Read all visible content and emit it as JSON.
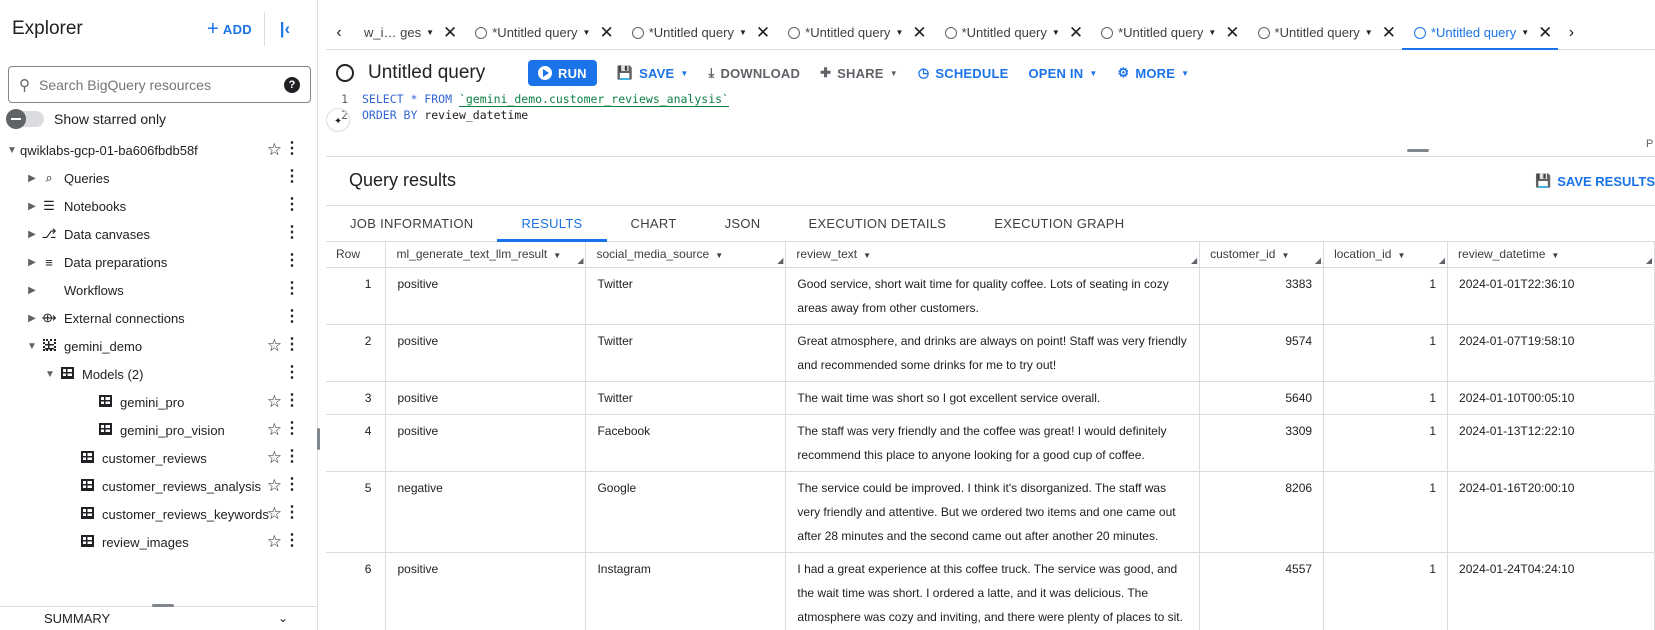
{
  "explorer": {
    "title": "Explorer",
    "add_label": "ADD",
    "search_placeholder": "Search BigQuery resources",
    "starred_label": "Show starred only",
    "project": "qwiklabs-gcp-01-ba606fbdb58f",
    "project_items": [
      {
        "label": "Queries",
        "icon": "queries-icon"
      },
      {
        "label": "Notebooks",
        "icon": "notebook-icon"
      },
      {
        "label": "Data canvases",
        "icon": "data-canvas-icon"
      },
      {
        "label": "Data preparations",
        "icon": "data-prep-icon"
      },
      {
        "label": "Workflows",
        "icon": "workflow-icon"
      },
      {
        "label": "External connections",
        "icon": "connection-icon"
      }
    ],
    "dataset": "gemini_demo",
    "models_label": "Models (2)",
    "models": [
      "gemini_pro",
      "gemini_pro_vision"
    ],
    "tables": [
      "customer_reviews",
      "customer_reviews_analysis",
      "customer_reviews_keywords",
      "review_images"
    ],
    "summary_label": "SUMMARY"
  },
  "tabs": {
    "first_tab": "w_i…  ges",
    "untitled": "*Untitled query",
    "untitled_count": 7
  },
  "toolbar": {
    "title": "Untitled query",
    "run": "RUN",
    "save": "SAVE",
    "download": "DOWNLOAD",
    "share": "SHARE",
    "schedule": "SCHEDULE",
    "open_in": "OPEN IN",
    "more": "MORE"
  },
  "editor": {
    "line1_kw": "SELECT * FROM",
    "line1_table": "`gemini_demo.customer_reviews_analysis`",
    "line2_kw": "ORDER BY",
    "line2_col": "review_datetime",
    "corner_text": "P"
  },
  "results": {
    "title": "Query results",
    "save_results": "SAVE RESULTS",
    "tabs": [
      "JOB INFORMATION",
      "RESULTS",
      "CHART",
      "JSON",
      "EXECUTION DETAILS",
      "EXECUTION GRAPH"
    ],
    "active_tab": "RESULTS",
    "columns": [
      "Row",
      "ml_generate_text_llm_result",
      "social_media_source",
      "review_text",
      "customer_id",
      "location_id",
      "review_datetime"
    ],
    "rows": [
      {
        "row": "1",
        "result": "positive",
        "source": "Twitter",
        "text": "Good service, short wait time for quality coffee.  Lots of seating in cozy areas away from other customers.",
        "customer_id": "3383",
        "location_id": "1",
        "datetime": "2024-01-01T22:36:10"
      },
      {
        "row": "2",
        "result": "positive",
        "source": "Twitter",
        "text": "Great atmosphere,  and drinks are always on point! Staff was very friendly and recommended some drinks for me to try out!",
        "customer_id": "9574",
        "location_id": "1",
        "datetime": "2024-01-07T19:58:10"
      },
      {
        "row": "3",
        "result": "positive",
        "source": "Twitter",
        "text": "The wait time was short so I got excellent service overall.",
        "customer_id": "5640",
        "location_id": "1",
        "datetime": "2024-01-10T00:05:10"
      },
      {
        "row": "4",
        "result": "positive",
        "source": "Facebook",
        "text": "The staff was very friendly and the coffee was great! I would definitely recommend this place to anyone looking for a good cup of coffee.",
        "customer_id": "3309",
        "location_id": "1",
        "datetime": "2024-01-13T12:22:10"
      },
      {
        "row": "5",
        "result": "negative",
        "source": "Google",
        "text": "The service could be improved. I think it's disorganized.  The staff was very friendly and attentive.  But we ordered two items and one came out after 28 minutes and the second came out after another 20 minutes.",
        "customer_id": "8206",
        "location_id": "1",
        "datetime": "2024-01-16T20:00:10"
      },
      {
        "row": "6",
        "result": "positive",
        "source": "Instagram",
        "text": "I had a great experience at this coffee truck. The service was good, and the wait time was short. I ordered a latte, and it was delicious. The atmosphere was cozy and inviting, and there were plenty of places to sit. I would definitely recommend this coffee truck to others.",
        "customer_id": "4557",
        "location_id": "1",
        "datetime": "2024-01-24T04:24:10"
      }
    ]
  },
  "colors": {
    "accent": "#1a73e8",
    "text": "#202124",
    "border": "#dadce0"
  }
}
